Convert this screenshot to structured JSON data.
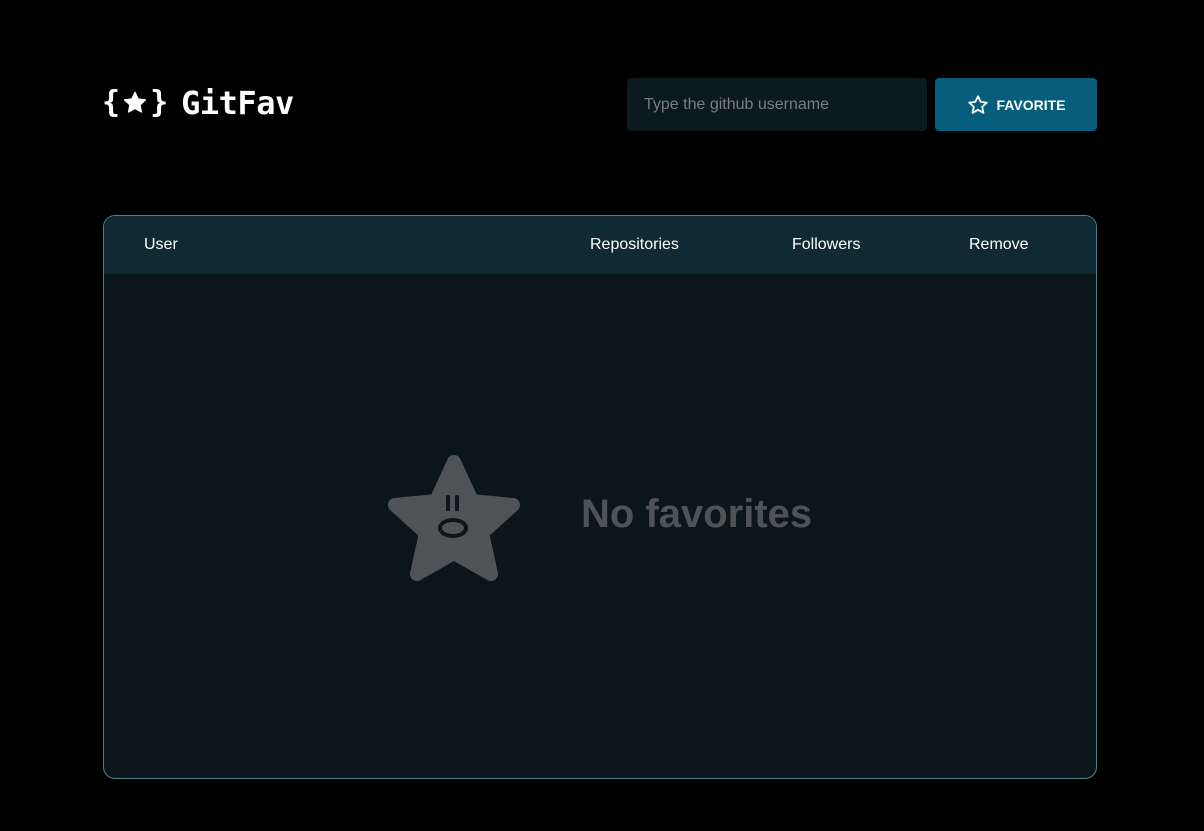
{
  "header": {
    "logo_text": "GitFav",
    "logo_brace_open": "{",
    "logo_brace_close": "}",
    "search_placeholder": "Type the github username",
    "search_value": "",
    "favorite_button_label": "FAVORITE"
  },
  "table": {
    "columns": [
      "User",
      "Repositories",
      "Followers",
      "Remove"
    ],
    "rows": [],
    "empty_message": "No favorites"
  },
  "colors": {
    "background": "#000000",
    "accent": "#065e7c",
    "header_row": "#102a33",
    "table_body": "#0a1619",
    "border": "#4a808c",
    "muted_text": "#4e5455"
  },
  "icons": {
    "logo": "star-icon",
    "favorite_button": "star-outline-icon",
    "empty_state": "surprised-star-icon"
  }
}
